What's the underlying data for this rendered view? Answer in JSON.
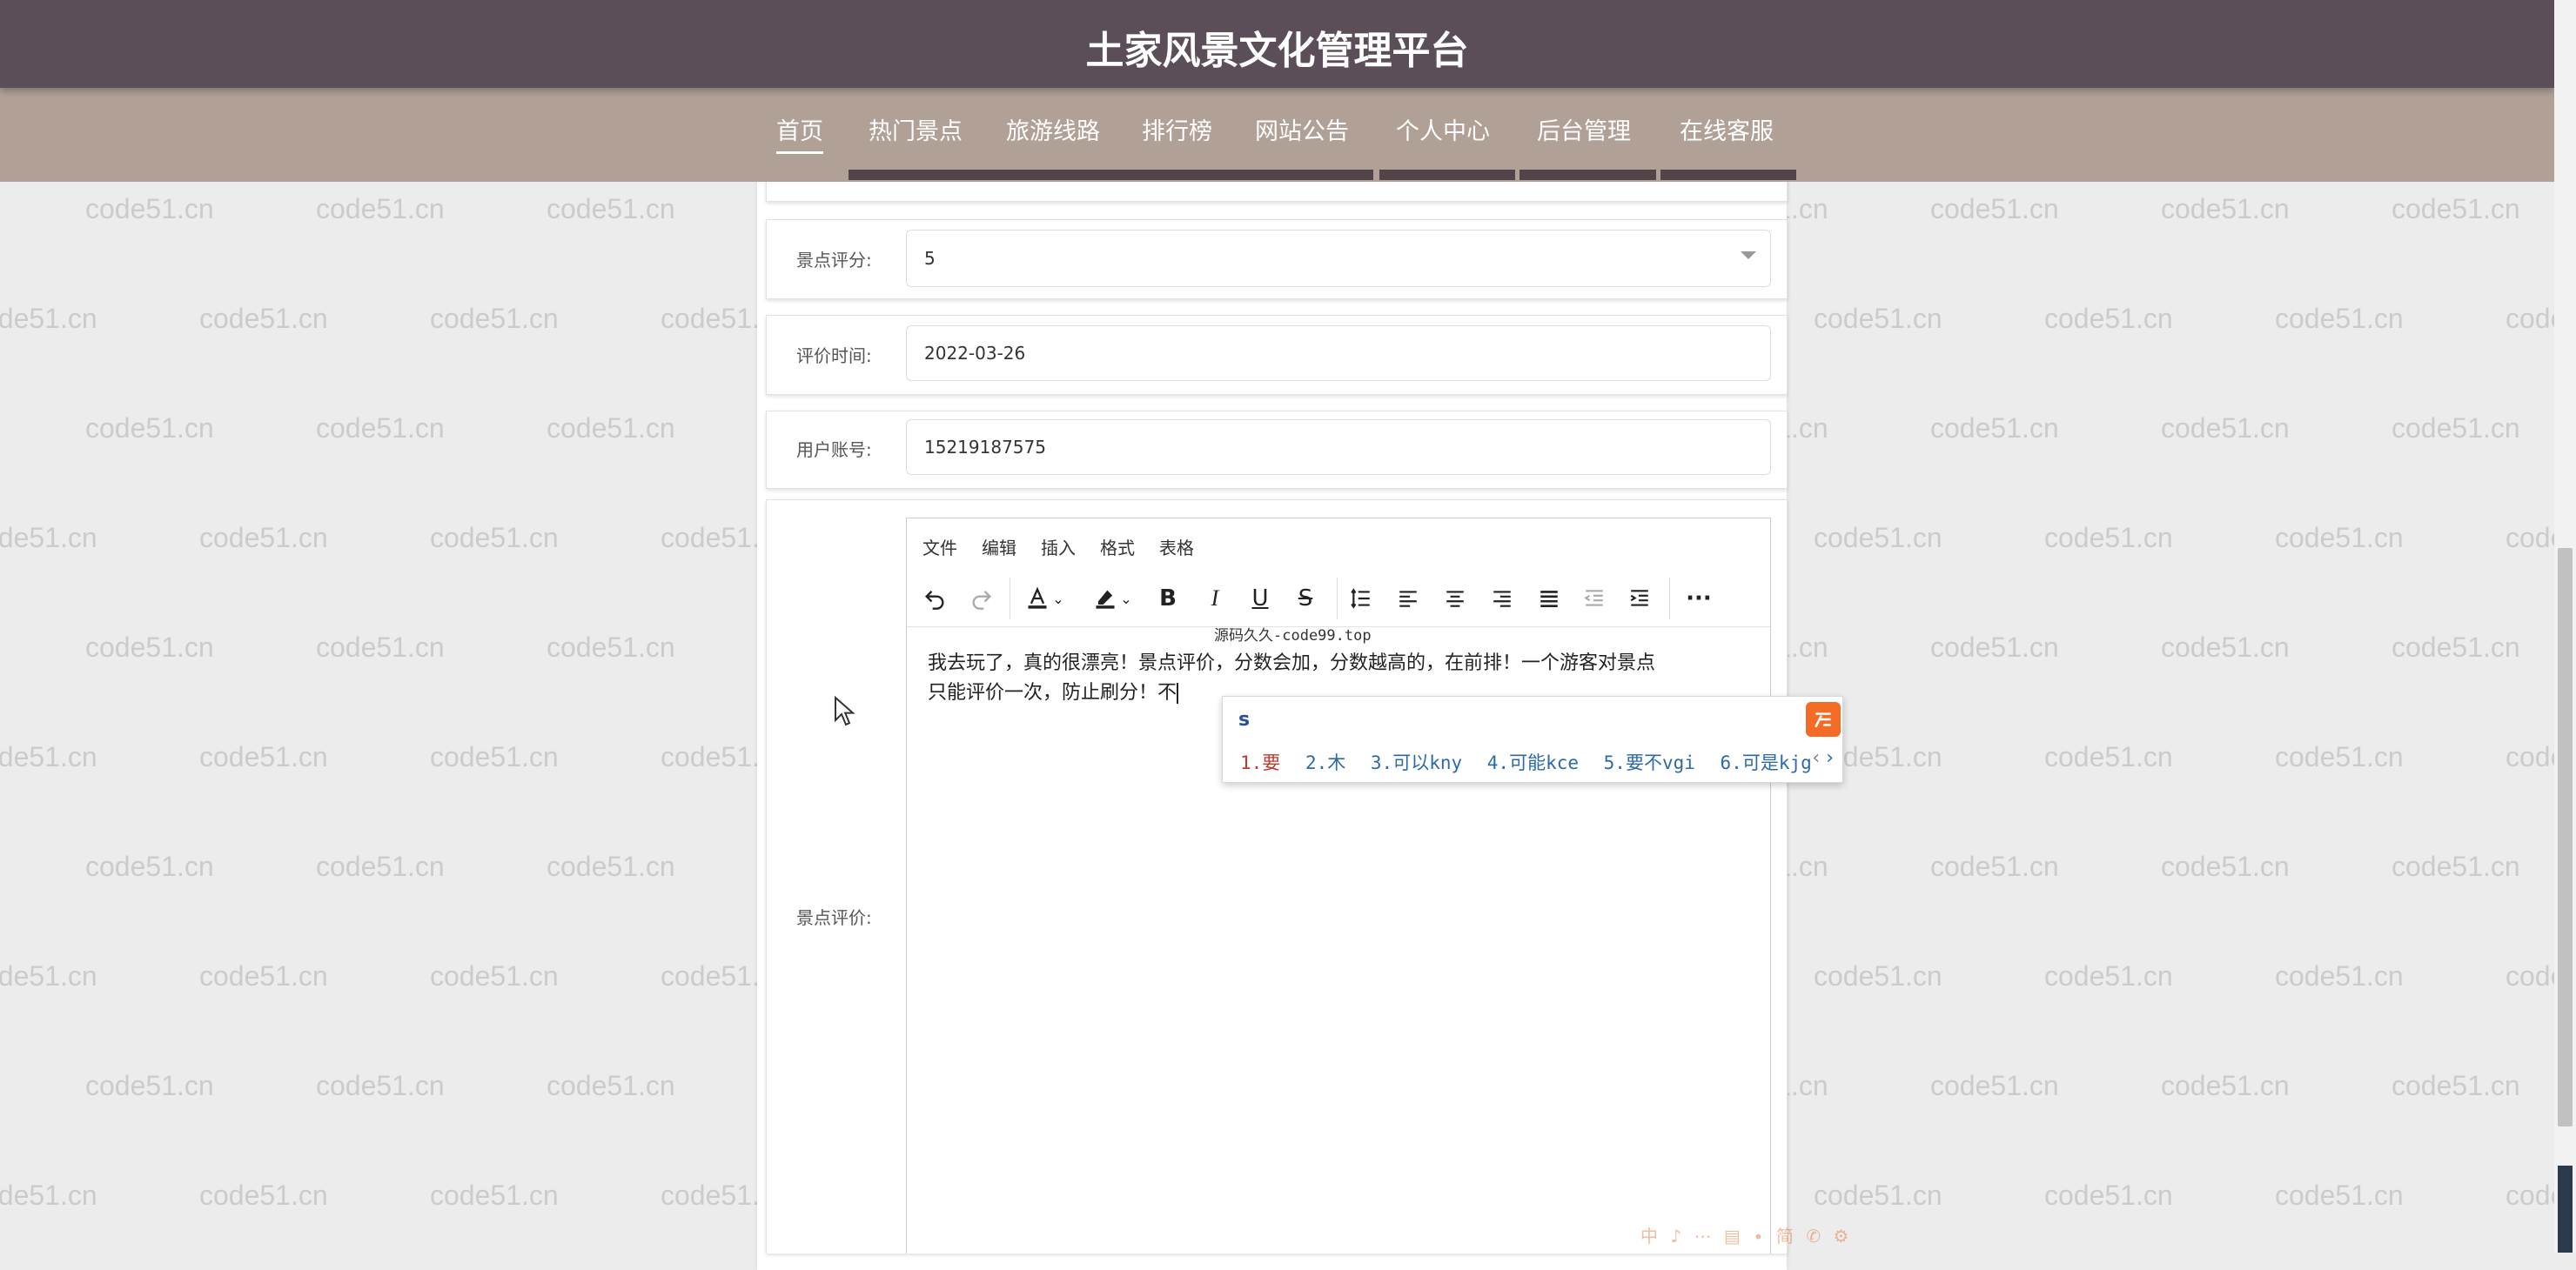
{
  "app": {
    "title": "土家风景文化管理平台"
  },
  "nav": {
    "items": [
      {
        "label": "首页",
        "active": true
      },
      {
        "label": "热门景点",
        "active": false
      },
      {
        "label": "旅游线路",
        "active": false
      },
      {
        "label": "排行榜",
        "active": false
      },
      {
        "label": "网站公告",
        "active": false
      },
      {
        "label": "个人中心",
        "active": false
      },
      {
        "label": "后台管理",
        "active": false
      },
      {
        "label": "在线客服",
        "active": false
      }
    ]
  },
  "watermark": {
    "text": "code51.cn"
  },
  "form": {
    "rating": {
      "label": "景点评分:",
      "value": "5"
    },
    "review_time": {
      "label": "评价时间:",
      "value": "2022-03-26"
    },
    "user_account": {
      "label": "用户账号:",
      "value": "15219187575"
    },
    "review": {
      "label": "景点评价:"
    }
  },
  "editor": {
    "menu": [
      "文件",
      "编辑",
      "插入",
      "格式",
      "表格"
    ],
    "toolbar": {
      "undo": "undo-icon",
      "redo": "redo-icon",
      "font_color": "font-color-icon",
      "highlight": "highlight-icon",
      "bold": "B",
      "italic": "I",
      "underline": "U",
      "strikethrough": "S",
      "more": "···"
    },
    "content_line1": "我去玩了，真的很漂亮！景点评价，分数会加，分数越高的，在前排！一个游客对景点",
    "content_line2": "只能评价一次，防止刷分！不"
  },
  "overlay_text": "源码久久-code99.top",
  "ime": {
    "input": "s",
    "candidates": [
      "1.要",
      "2.木",
      "3.可以kny",
      "4.可能kce",
      "5.要不vgi",
      "6.可是kjg"
    ],
    "nav_prev": "‹",
    "nav_next": "›"
  },
  "ime_status": "中 ♪ ⋯ ▤ ∙ 简 ✆ ⚙",
  "colors": {
    "header": "#5b4e58",
    "navbar": "#b0a096",
    "ime_logo": "#f36b24"
  }
}
